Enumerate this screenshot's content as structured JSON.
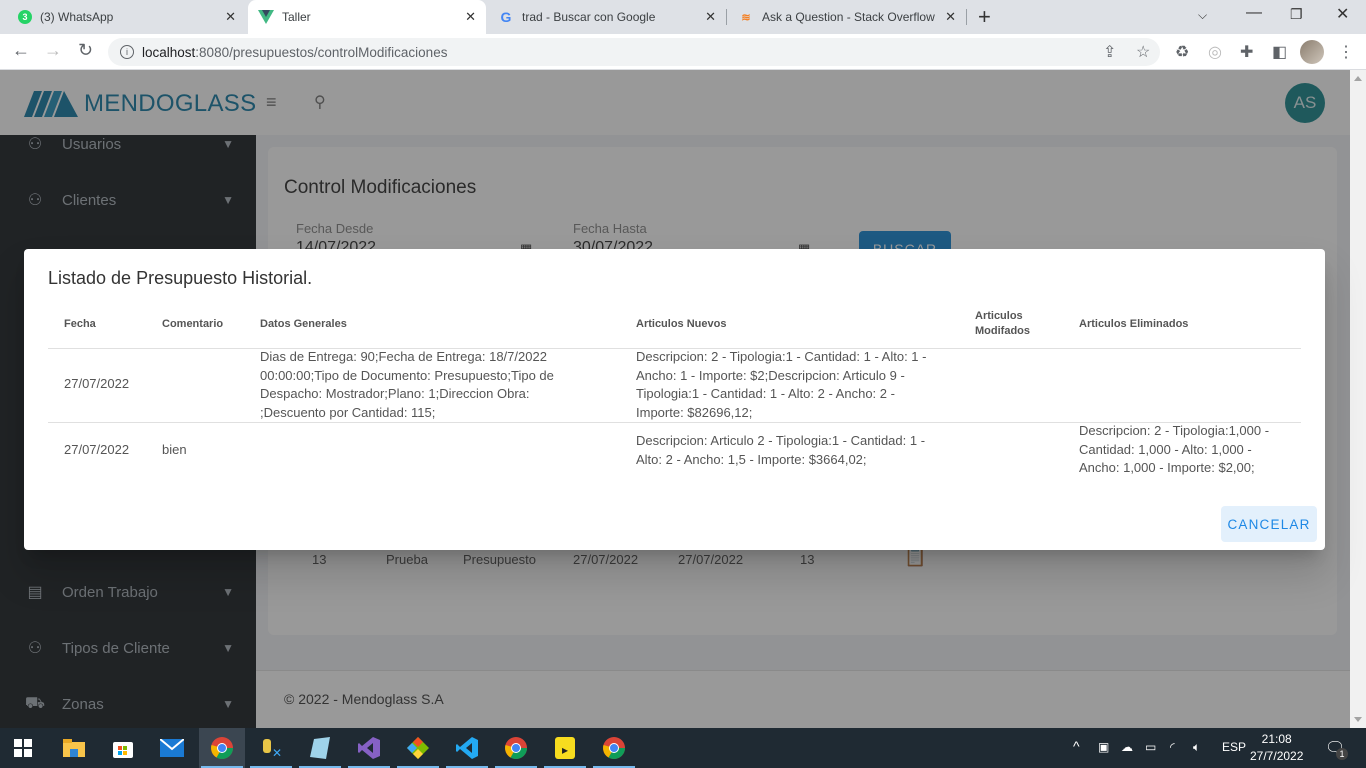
{
  "browser": {
    "tabs": [
      {
        "title": "(3) WhatsApp",
        "icon": "whatsapp-icon",
        "badge": "3"
      },
      {
        "title": "Taller",
        "icon": "vue-icon",
        "active": true
      },
      {
        "title": "trad - Buscar con Google",
        "icon": "google-icon"
      },
      {
        "title": "Ask a Question - Stack Overflow",
        "icon": "stackoverflow-icon"
      }
    ],
    "url_host": "localhost",
    "url_path": ":8080/presupuestos/controlModificaciones"
  },
  "app": {
    "brand": "MENDOGLASS",
    "avatar_initials": "AS",
    "sidebar": [
      {
        "label": "Usuarios",
        "icon": "user-icon"
      },
      {
        "label": "Clientes",
        "icon": "users-icon"
      },
      {
        "label": "Orden Trabajo",
        "icon": "layout-icon"
      },
      {
        "label": "Tipos de Cliente",
        "icon": "users-icon"
      },
      {
        "label": "Zonas",
        "icon": "truck-icon"
      }
    ],
    "page_title": "Control Modificaciones",
    "filters": {
      "desde_label": "Fecha Desde",
      "desde_value": "14/07/2022",
      "hasta_label": "Fecha Hasta",
      "hasta_value": "30/07/2022",
      "buscar_label": "BUSCAR"
    },
    "background_row": [
      "13",
      "Prueba",
      "Presupuesto",
      "27/07/2022",
      "27/07/2022",
      "13"
    ],
    "footer": "© 2022 - Mendoglass S.A"
  },
  "modal": {
    "title": "Listado de Presupuesto Historial.",
    "columns": [
      "Fecha",
      "Comentario",
      "Datos Generales",
      "Articulos Nuevos",
      "Articulos Modifados",
      "Articulos Eliminados"
    ],
    "rows": [
      {
        "fecha": "27/07/2022",
        "comentario": "",
        "datos_generales": "Dias de Entrega: 90;Fecha de Entrega: 18/7/2022 00:00:00;Tipo de Documento: Presupuesto;Tipo de Despacho: Mostrador;Plano: 1;Direccion Obra: ;Descuento por Cantidad: 115;",
        "articulos_nuevos": "Descripcion: 2 - Tipologia:1 - Cantidad: 1 - Alto: 1 - Ancho: 1 - Importe: $2;Descripcion: Articulo 9 - Tipologia:1 - Cantidad: 1 - Alto: 2 - Ancho: 2 - Importe: $82696,12;",
        "articulos_modificados": "",
        "articulos_eliminados": ""
      },
      {
        "fecha": "27/07/2022",
        "comentario": "bien",
        "datos_generales": "",
        "articulos_nuevos": "Descripcion: Articulo 2 - Tipologia:1 - Cantidad: 1 - Alto: 2 - Ancho: 1,5 - Importe: $3664,02;",
        "articulos_modificados": "",
        "articulos_eliminados": "Descripcion: 2 - Tipologia:1,000 - Cantidad: 1,000 - Alto: 1,000 - Ancho: 1,000 - Importe: $2,00;"
      }
    ],
    "cancel_label": "CANCELAR"
  },
  "taskbar": {
    "apps": [
      "windows-start-icon",
      "file-explorer-icon",
      "store-icon",
      "mail-icon",
      "chrome-icon",
      "db-tool-icon",
      "notepad-icon",
      "visual-studio-icon",
      "git-icon",
      "vscode-icon",
      "chrome-icon",
      "sticky-app-icon",
      "chrome-icon"
    ],
    "language": "ESP",
    "time": "21:08",
    "date": "27/7/2022",
    "notifications": "1"
  }
}
